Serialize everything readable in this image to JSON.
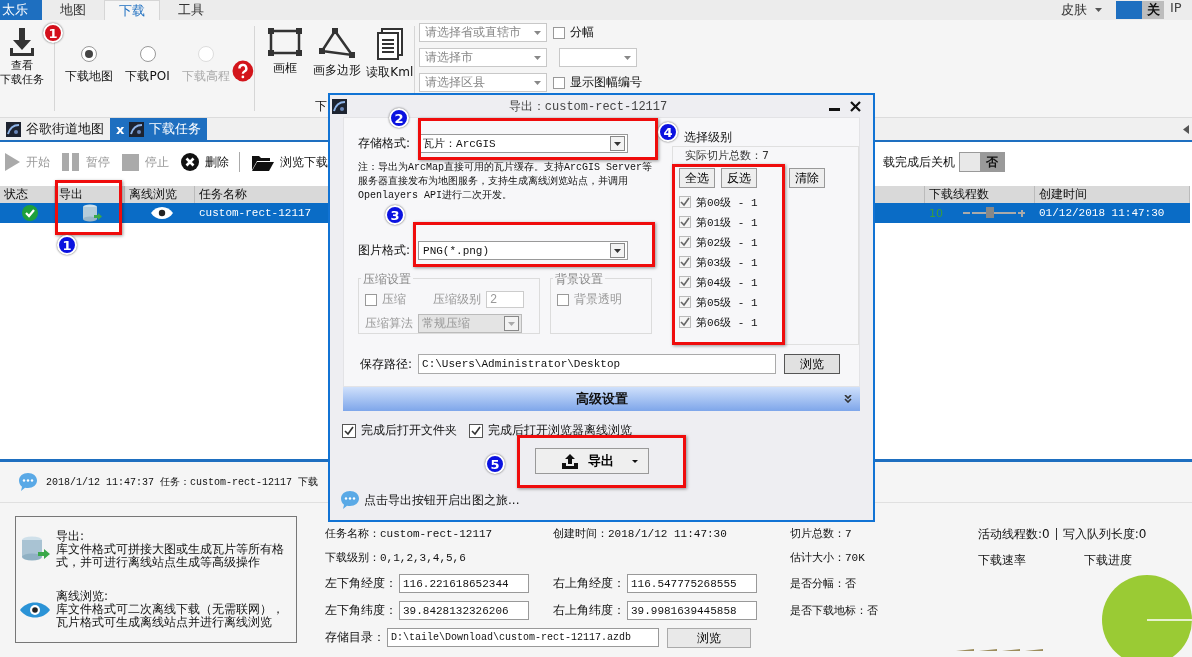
{
  "app_tab": "太乐",
  "menu_tabs": [
    {
      "label": "地图",
      "selected": false
    },
    {
      "label": "下载",
      "selected": true
    },
    {
      "label": "工具",
      "selected": false
    }
  ],
  "skin_menu": "皮肤",
  "close_toggle": {
    "label": "关",
    "on": true
  },
  "ip_label": "IP",
  "ribbon": {
    "view_tasks": [
      "查看",
      "下载任务"
    ],
    "download_modes": [
      {
        "label": "下载地图",
        "selected": true,
        "disabled": false
      },
      {
        "label": "下载POI",
        "selected": false,
        "disabled": false
      },
      {
        "label": "下载高程",
        "selected": false,
        "disabled": true
      }
    ],
    "draw_tools": [
      {
        "kind": "rect",
        "label": "画框"
      },
      {
        "kind": "polygon",
        "label": "画多边形"
      },
      {
        "kind": "kml",
        "label": "读取Kml"
      }
    ],
    "region_selects": [
      {
        "placeholder": "请选择省或直辖市"
      },
      {
        "placeholder": "请选择市"
      },
      {
        "placeholder": "请选择区县"
      }
    ],
    "options": [
      {
        "kind": "checkbox",
        "label": "分幅",
        "checked": false
      },
      {
        "kind": "select"
      },
      {
        "kind": "checkbox",
        "label": "显示图幅编号",
        "checked": false
      }
    ],
    "group_label": "下"
  },
  "doc_tabs": [
    {
      "label": "谷歌街道地图",
      "selected": false
    },
    {
      "label": "下载任务",
      "selected": true,
      "close": "x"
    }
  ],
  "toolbar": [
    {
      "kind": "play",
      "label": "开始",
      "disabled": true
    },
    {
      "kind": "pause",
      "label": "暂停",
      "disabled": true
    },
    {
      "kind": "stop",
      "label": "停止",
      "disabled": true
    },
    {
      "kind": "delete",
      "label": "删除",
      "disabled": false
    },
    {
      "kind": "folder",
      "label": "浏览下载",
      "disabled": false
    }
  ],
  "shutdown": {
    "label": "载完成后关机",
    "value": "否",
    "on": false
  },
  "table": {
    "columns": [
      "状态",
      "导出",
      "离线浏览",
      "任务名称",
      "下载线程数",
      "创建时间"
    ],
    "rows": [
      {
        "selected": true,
        "task_name": "custom-rect-12117",
        "threads": "10",
        "level": 0.4,
        "created": "01/12/2018 11:47:30"
      }
    ]
  },
  "dialog": {
    "title": "导出：custom-rect-12117",
    "storage_label": "存储格式:",
    "storage_value": "瓦片：ArcGIS",
    "note": "注：导出为ArcMap直接可用的瓦片缓存。支持ArcGIS Server等服务器直接发布为地图服务，支持生成离线浏览站点，并调用Openlayers API进行二次开发。",
    "image_label": "图片格式:",
    "image_value": "PNG(*.png)",
    "compression": {
      "title": "压缩设置",
      "label": "压缩",
      "checked": false,
      "level_label": "压缩级别",
      "level_value": "2",
      "algo_label": "压缩算法",
      "algo_value": "常规压缩",
      "disabled": true
    },
    "background": {
      "title": "背景设置",
      "label": "背景透明",
      "checked": false,
      "disabled": true
    },
    "levels": {
      "title": "选择级别",
      "total": "实际切片总数：7",
      "buttons": [
        "全选",
        "反选",
        "清除"
      ],
      "items": [
        {
          "label": "第00级 - 1",
          "checked": true
        },
        {
          "label": "第01级 - 1",
          "checked": true
        },
        {
          "label": "第02级 - 1",
          "checked": true
        },
        {
          "label": "第03级 - 1",
          "checked": true
        },
        {
          "label": "第04级 - 1",
          "checked": true
        },
        {
          "label": "第05级 - 1",
          "checked": true
        },
        {
          "label": "第06级 - 1",
          "checked": true
        }
      ]
    },
    "path_label": "保存路径:",
    "path_value": "C:\\Users\\Administrator\\Desktop",
    "browse": "浏览",
    "advanced": "高级设置",
    "after_options": [
      {
        "label": "完成后打开文件夹",
        "checked": true
      },
      {
        "label": "完成后打开浏览器离线浏览",
        "checked": true
      }
    ],
    "export_button": "导出",
    "hint": "点击导出按钮开启出图之旅..."
  },
  "status_message": "2018/1/12 11:47:37 任务：custom-rect-12117 下载",
  "legend": [
    {
      "kind": "export",
      "title": "导出:",
      "text": "库文件格式可拼接大图或生成瓦片等所有格式，并可进行离线站点生成等高级操作"
    },
    {
      "kind": "browse",
      "title": "离线浏览:",
      "text": "库文件格式可二次离线下载（无需联网），瓦片格式可生成离线站点并进行离线浏览"
    }
  ],
  "task_info": {
    "name": "任务名称：custom-rect-12117",
    "created": "创建时间：2018/1/12 11:47:30",
    "tiles": "切片总数：7",
    "levels": "下载级别：0,1,2,3,4,5,6",
    "size": "估计大小：70K",
    "lower_left_lon": {
      "label": "左下角经度：",
      "value": "116.221618652344"
    },
    "upper_right_lon": {
      "label": "右上角经度：",
      "value": "116.547775268555"
    },
    "split": "是否分幅：否",
    "lower_left_lat": {
      "label": "左下角纬度：",
      "value": "39.8428132326206"
    },
    "upper_right_lat": {
      "label": "右上角纬度：",
      "value": "39.9981639445858"
    },
    "landmark": "是否下载地标：否",
    "directory": {
      "label": "存储目录：",
      "value": "D:\\taile\\Download\\custom-rect-12117.azdb"
    },
    "browse": "浏览"
  },
  "stats": {
    "threads": "活动线程数:0",
    "queue": "写入队列长度:0",
    "speed": "下载速率",
    "progress": "下载进度"
  },
  "markers": [
    {
      "label": "1",
      "color": "#d4101c"
    },
    {
      "label": "1",
      "color": "#0b12e0"
    },
    {
      "label": "2",
      "color": "#0b12e0"
    },
    {
      "label": "3",
      "color": "#0b12e0"
    },
    {
      "label": "4",
      "color": "#0b12e0"
    },
    {
      "label": "5",
      "color": "#0b12e0"
    }
  ]
}
